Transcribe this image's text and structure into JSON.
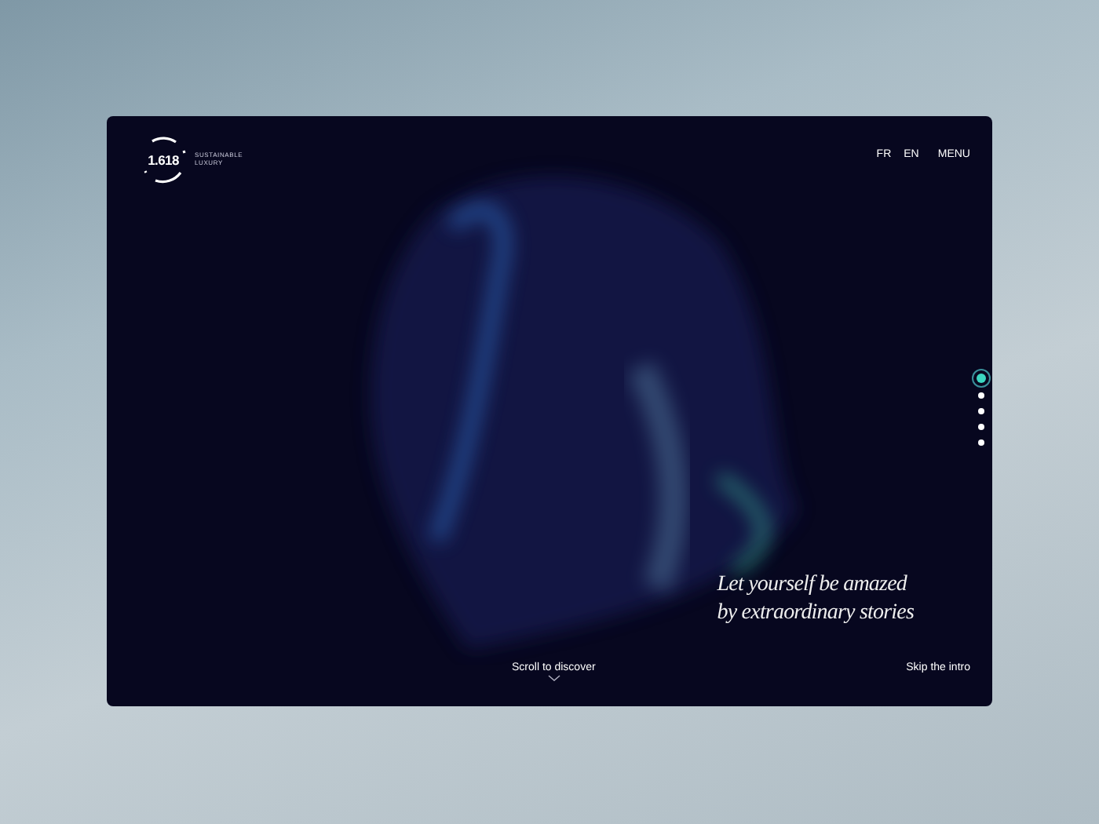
{
  "logo": {
    "number": "1.618",
    "tagline": "SUSTAINABLE LUXURY"
  },
  "languages": [
    "FR",
    "EN"
  ],
  "menu": {
    "label": "MENU"
  },
  "slides": [
    {
      "selected": true
    },
    {
      "selected": false
    },
    {
      "selected": false
    },
    {
      "selected": false
    },
    {
      "selected": false
    }
  ],
  "headline": [
    "Let yourself be amazed",
    "by extraordinary stories"
  ],
  "scroll_hint": "Scroll to discover",
  "skip": "Skip the intro"
}
